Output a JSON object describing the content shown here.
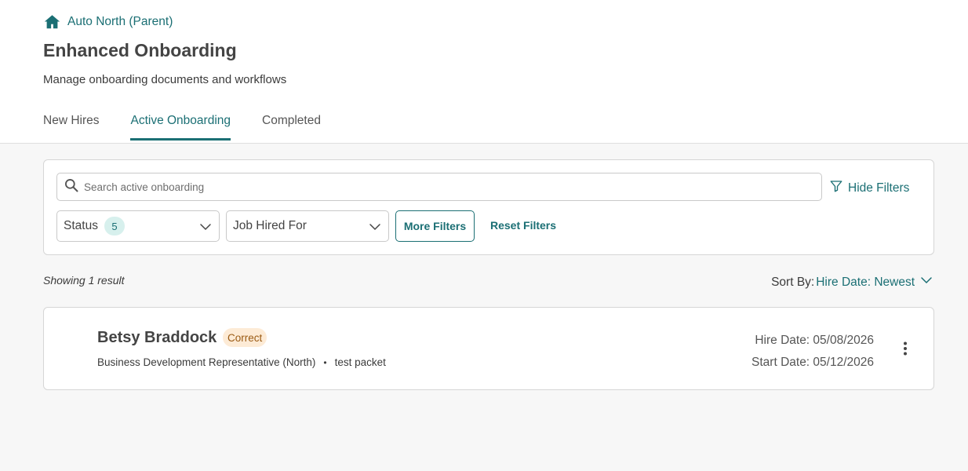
{
  "breadcrumb": {
    "icon": "home-icon",
    "label": "Auto North (Parent)"
  },
  "page": {
    "title": "Enhanced Onboarding",
    "subtitle": "Manage onboarding documents and workflows"
  },
  "tabs": [
    {
      "label": "New Hires",
      "active": false
    },
    {
      "label": "Active Onboarding",
      "active": true
    },
    {
      "label": "Completed",
      "active": false
    }
  ],
  "filters": {
    "search_placeholder": "Search active onboarding",
    "search_value": "",
    "hide_filters_label": "Hide Filters",
    "status_label": "Status",
    "status_count": "5",
    "job_label": "Job Hired For",
    "more_filters_label": "More Filters",
    "reset_filters_label": "Reset Filters"
  },
  "results": {
    "showing_text": "Showing 1 result",
    "sort_label": "Sort By:",
    "sort_value": "Hire Date: Newest"
  },
  "records": [
    {
      "name": "Betsy Braddock",
      "status": "Correct",
      "job": "Business Development Representative (North)",
      "packet": "test packet",
      "hire_date": "Hire Date: 05/08/2026",
      "start_date": "Start Date: 05/12/2026"
    }
  ],
  "colors": {
    "accent": "#1b6f74",
    "status_pill_bg": "#fdebd6",
    "status_pill_text": "#9a5a13",
    "badge_bg": "#d7f0ed"
  }
}
